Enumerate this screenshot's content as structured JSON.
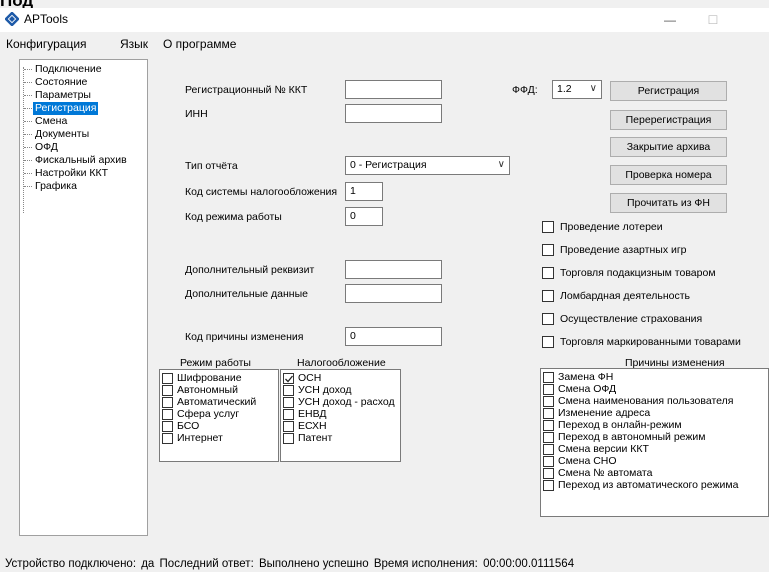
{
  "window": {
    "title": "APTools",
    "minimize_glyph": "—",
    "maximize_glyph": "☐",
    "top_cut_text": "Под"
  },
  "menu": [
    "Конфигурация",
    "Язык",
    "О программе"
  ],
  "tree": [
    "Подключение",
    "Состояние",
    "Параметры",
    "Регистрация",
    "Смена",
    "Документы",
    "ОФД",
    "Фискальный архив",
    "Настройки ККТ",
    "Графика"
  ],
  "tree_selected": "Регистрация",
  "form": {
    "reg_number_label": "Регистрационный № ККТ",
    "reg_number_value": "",
    "inn_label": "ИНН",
    "inn_value": "",
    "report_type_label": "Тип отчёта",
    "report_type_value": "0 - Регистрация",
    "tax_system_label": "Код системы налогообложения",
    "tax_system_value": "1",
    "work_mode_label": "Код режима работы",
    "work_mode_value": "0",
    "extra_req_label": "Дополнительный реквизит",
    "extra_req_value": "",
    "extra_data_label": "Дополнительные данные",
    "extra_data_value": "",
    "change_reason_label": "Код причины изменения",
    "change_reason_value": "0",
    "ffd_label": "ФФД:",
    "ffd_value": "1.2"
  },
  "buttons": [
    "Регистрация",
    "Перерегистрация",
    "Закрытие архива",
    "Проверка номера",
    "Прочитать из ФН"
  ],
  "activities": [
    {
      "label": "Проведение лотереи",
      "checked": false
    },
    {
      "label": "Проведение азартных игр",
      "checked": false
    },
    {
      "label": "Торговля подакцизным товаром",
      "checked": false
    },
    {
      "label": "Ломбардная деятельность",
      "checked": false
    },
    {
      "label": "Осуществление страхования",
      "checked": false
    },
    {
      "label": "Торговля маркированными товарами",
      "checked": false
    }
  ],
  "work_modes": {
    "title": "Режим работы",
    "items": [
      {
        "label": "Шифрование",
        "checked": false
      },
      {
        "label": "Автономный",
        "checked": false
      },
      {
        "label": "Автоматический",
        "checked": false
      },
      {
        "label": "Сфера услуг",
        "checked": false
      },
      {
        "label": "БСО",
        "checked": false
      },
      {
        "label": "Интернет",
        "checked": false
      }
    ]
  },
  "taxation": {
    "title": "Налогообложение",
    "items": [
      {
        "label": "ОСН",
        "checked": true
      },
      {
        "label": "УСН доход",
        "checked": false
      },
      {
        "label": "УСН доход - расход",
        "checked": false
      },
      {
        "label": "ЕНВД",
        "checked": false
      },
      {
        "label": "ЕСХН",
        "checked": false
      },
      {
        "label": "Патент",
        "checked": false
      }
    ]
  },
  "reasons": {
    "title": "Причины изменения",
    "items": [
      {
        "label": "Замена ФН",
        "checked": false
      },
      {
        "label": "Смена ОФД",
        "checked": false
      },
      {
        "label": "Смена наименования пользователя",
        "checked": false
      },
      {
        "label": "Изменение адреса",
        "checked": false
      },
      {
        "label": "Переход в онлайн-режим",
        "checked": false
      },
      {
        "label": "Переход в автономный режим",
        "checked": false
      },
      {
        "label": "Смена версии ККТ",
        "checked": false
      },
      {
        "label": "Смена СНО",
        "checked": false
      },
      {
        "label": "Смена № автомата",
        "checked": false
      },
      {
        "label": "Переход из автоматического режима",
        "checked": false
      }
    ]
  },
  "status": {
    "connected_label": "Устройство подключено:",
    "connected_value": "да",
    "last_answer_label": "Последний ответ:",
    "last_answer_value": "Выполнено успешно",
    "exec_time_label": "Время исполнения:",
    "exec_time_value": "00:00:00.0111564"
  },
  "colors": {
    "selection": "#0078d7",
    "window_bg": "#f0f0f0",
    "brand_icon": "#1e5aa8"
  }
}
